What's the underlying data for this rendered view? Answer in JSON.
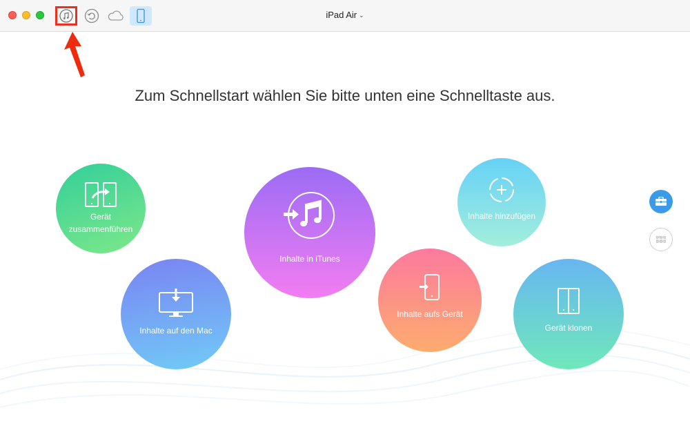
{
  "window": {
    "device_name": "iPad Air",
    "device_caret": "⌄"
  },
  "toolbar": {
    "icons": [
      "itunes-library-icon",
      "restore-backup-icon",
      "icloud-icon",
      "device-icon"
    ],
    "active": "device-icon",
    "highlight_color": "#e8321f"
  },
  "main": {
    "heading": "Zum Schnellstart wählen Sie bitte unten eine Schnelltaste aus.",
    "shortcuts": {
      "merge": {
        "label_line1": "Gerät",
        "label_line2": "zusammenführen"
      },
      "itunes": {
        "label": "Inhalte in iTunes"
      },
      "add": {
        "label": "Inhalte hinzufügen"
      },
      "mac": {
        "label": "Inhalte auf den Mac"
      },
      "device": {
        "label": "Inhalte aufs Gerät"
      },
      "clone": {
        "label": "Gerät klonen"
      }
    }
  },
  "sidebar": {
    "buttons": [
      "toolbox-icon",
      "more-apps-icon"
    ],
    "accent": "#3b9be9"
  }
}
